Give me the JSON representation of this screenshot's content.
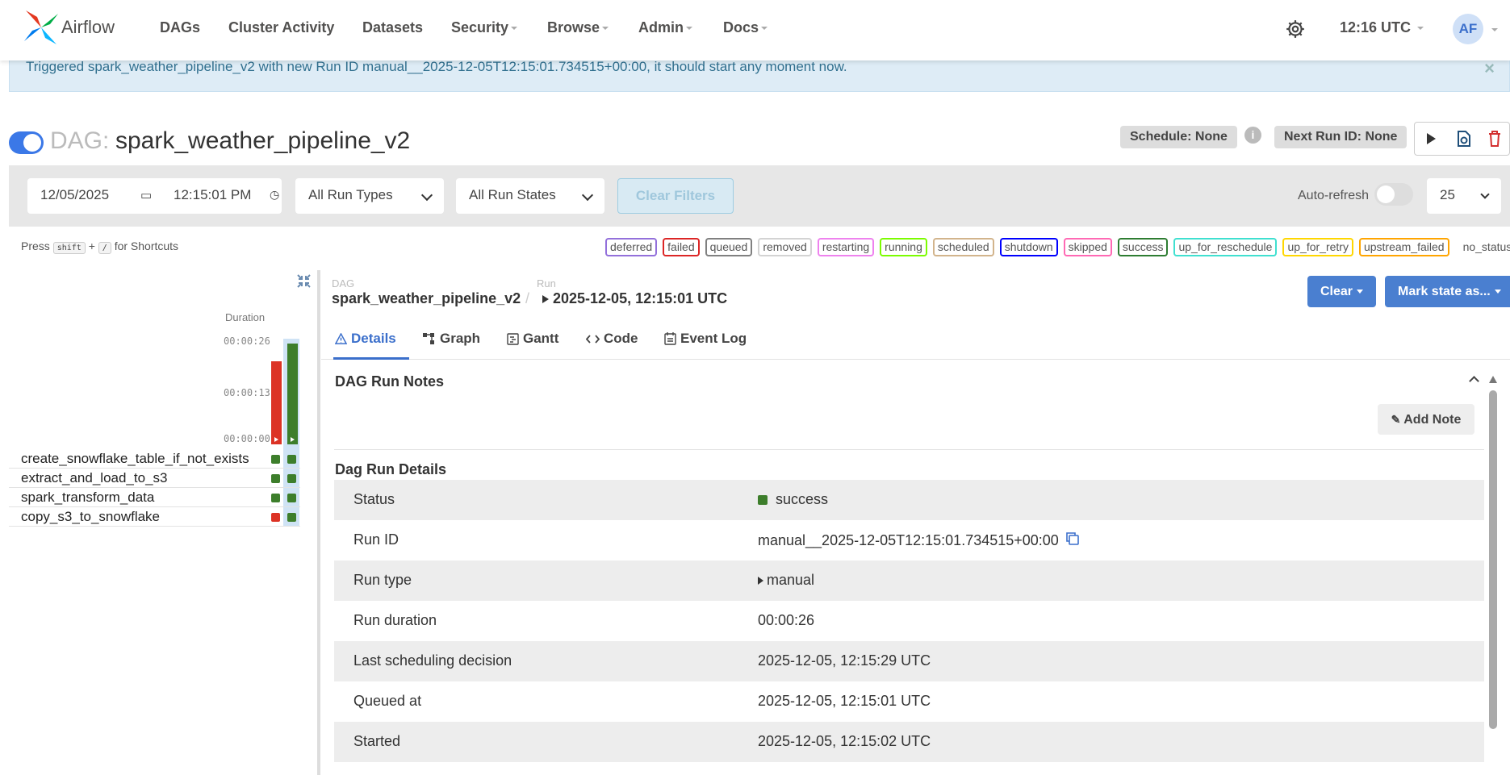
{
  "navbar": {
    "brand": "Airflow",
    "items": [
      {
        "label": "DAGs",
        "dropdown": false
      },
      {
        "label": "Cluster Activity",
        "dropdown": false
      },
      {
        "label": "Datasets",
        "dropdown": false
      },
      {
        "label": "Security",
        "dropdown": true
      },
      {
        "label": "Browse",
        "dropdown": true
      },
      {
        "label": "Admin",
        "dropdown": true
      },
      {
        "label": "Docs",
        "dropdown": true
      }
    ],
    "time": "12:16 UTC",
    "avatar": "AF"
  },
  "alert": {
    "message": "Triggered spark_weather_pipeline_v2 with new Run ID manual__2025-12-05T12:15:01.734515+00:00, it should start any moment now.",
    "close": "×"
  },
  "dag": {
    "prefix": "DAG:",
    "name": "spark_weather_pipeline_v2",
    "schedule": "Schedule: None",
    "info": "i",
    "next_run": "Next Run ID: None"
  },
  "filters": {
    "date": "12/05/2025",
    "time": "12:15:01 PM",
    "run_types": "All Run Types",
    "run_states": "All Run States",
    "clear": "Clear Filters",
    "autorefresh": "Auto-refresh",
    "page_size": "25"
  },
  "shortcuts": {
    "press": "Press",
    "key1": "shift",
    "plus": "+",
    "key2": "/",
    "suffix": "for Shortcuts"
  },
  "states": [
    {
      "label": "deferred",
      "color": "#9370db"
    },
    {
      "label": "failed",
      "color": "#dc2626"
    },
    {
      "label": "queued",
      "color": "#808080"
    },
    {
      "label": "removed",
      "color": "#d3d3d3"
    },
    {
      "label": "restarting",
      "color": "#ee82ee"
    },
    {
      "label": "running",
      "color": "#7cfc00"
    },
    {
      "label": "scheduled",
      "color": "#d2b48c"
    },
    {
      "label": "shutdown",
      "color": "#0000ff"
    },
    {
      "label": "skipped",
      "color": "#ff69b4"
    },
    {
      "label": "success",
      "color": "#2e7d32"
    },
    {
      "label": "up_for_reschedule",
      "color": "#40e0d0"
    },
    {
      "label": "up_for_retry",
      "color": "#ffd700"
    },
    {
      "label": "upstream_failed",
      "color": "#ffa500"
    },
    {
      "label": "no_status",
      "color": ""
    }
  ],
  "grid": {
    "duration_label": "Duration",
    "ticks": [
      "00:00:26",
      "00:00:13",
      "00:00:00"
    ],
    "runs": [
      {
        "duration_fraction": 0.82,
        "state": "failed",
        "color": "#dc3325"
      },
      {
        "duration_fraction": 1.0,
        "state": "success",
        "color": "#3d7e2b"
      }
    ],
    "tasks": [
      {
        "name": "create_snowflake_table_if_not_exists",
        "states": [
          "success",
          "success"
        ]
      },
      {
        "name": "extract_and_load_to_s3",
        "states": [
          "success",
          "success"
        ]
      },
      {
        "name": "spark_transform_data",
        "states": [
          "success",
          "success"
        ]
      },
      {
        "name": "copy_s3_to_snowflake",
        "states": [
          "failed",
          "success"
        ]
      }
    ]
  },
  "breadcrumb": {
    "dag_label": "DAG",
    "dag_value": "spark_weather_pipeline_v2",
    "sep": "/",
    "run_label": "Run",
    "run_value": "2025-12-05, 12:15:01 UTC"
  },
  "actions": {
    "clear": "Clear",
    "mark_state": "Mark state as..."
  },
  "tabs": [
    {
      "label": "Details",
      "icon": "warning-triangle-icon"
    },
    {
      "label": "Graph",
      "icon": "graph-icon"
    },
    {
      "label": "Gantt",
      "icon": "gantt-icon"
    },
    {
      "label": "Code",
      "icon": "code-icon"
    },
    {
      "label": "Event Log",
      "icon": "event-log-icon"
    }
  ],
  "notes": {
    "title": "DAG Run Notes",
    "add": "Add Note"
  },
  "details": {
    "title": "Dag Run Details",
    "rows": [
      {
        "key": "Status",
        "value": "success"
      },
      {
        "key": "Run ID",
        "value": "manual__2025-12-05T12:15:01.734515+00:00"
      },
      {
        "key": "Run type",
        "value": "manual"
      },
      {
        "key": "Run duration",
        "value": "00:00:26"
      },
      {
        "key": "Last scheduling decision",
        "value": "2025-12-05, 12:15:29 UTC"
      },
      {
        "key": "Queued at",
        "value": "2025-12-05, 12:15:01 UTC"
      },
      {
        "key": "Started",
        "value": "2025-12-05, 12:15:02 UTC"
      }
    ]
  },
  "colors": {
    "success": "#3d7e2b",
    "failed": "#dc3325",
    "accent": "#3b6fcb"
  }
}
